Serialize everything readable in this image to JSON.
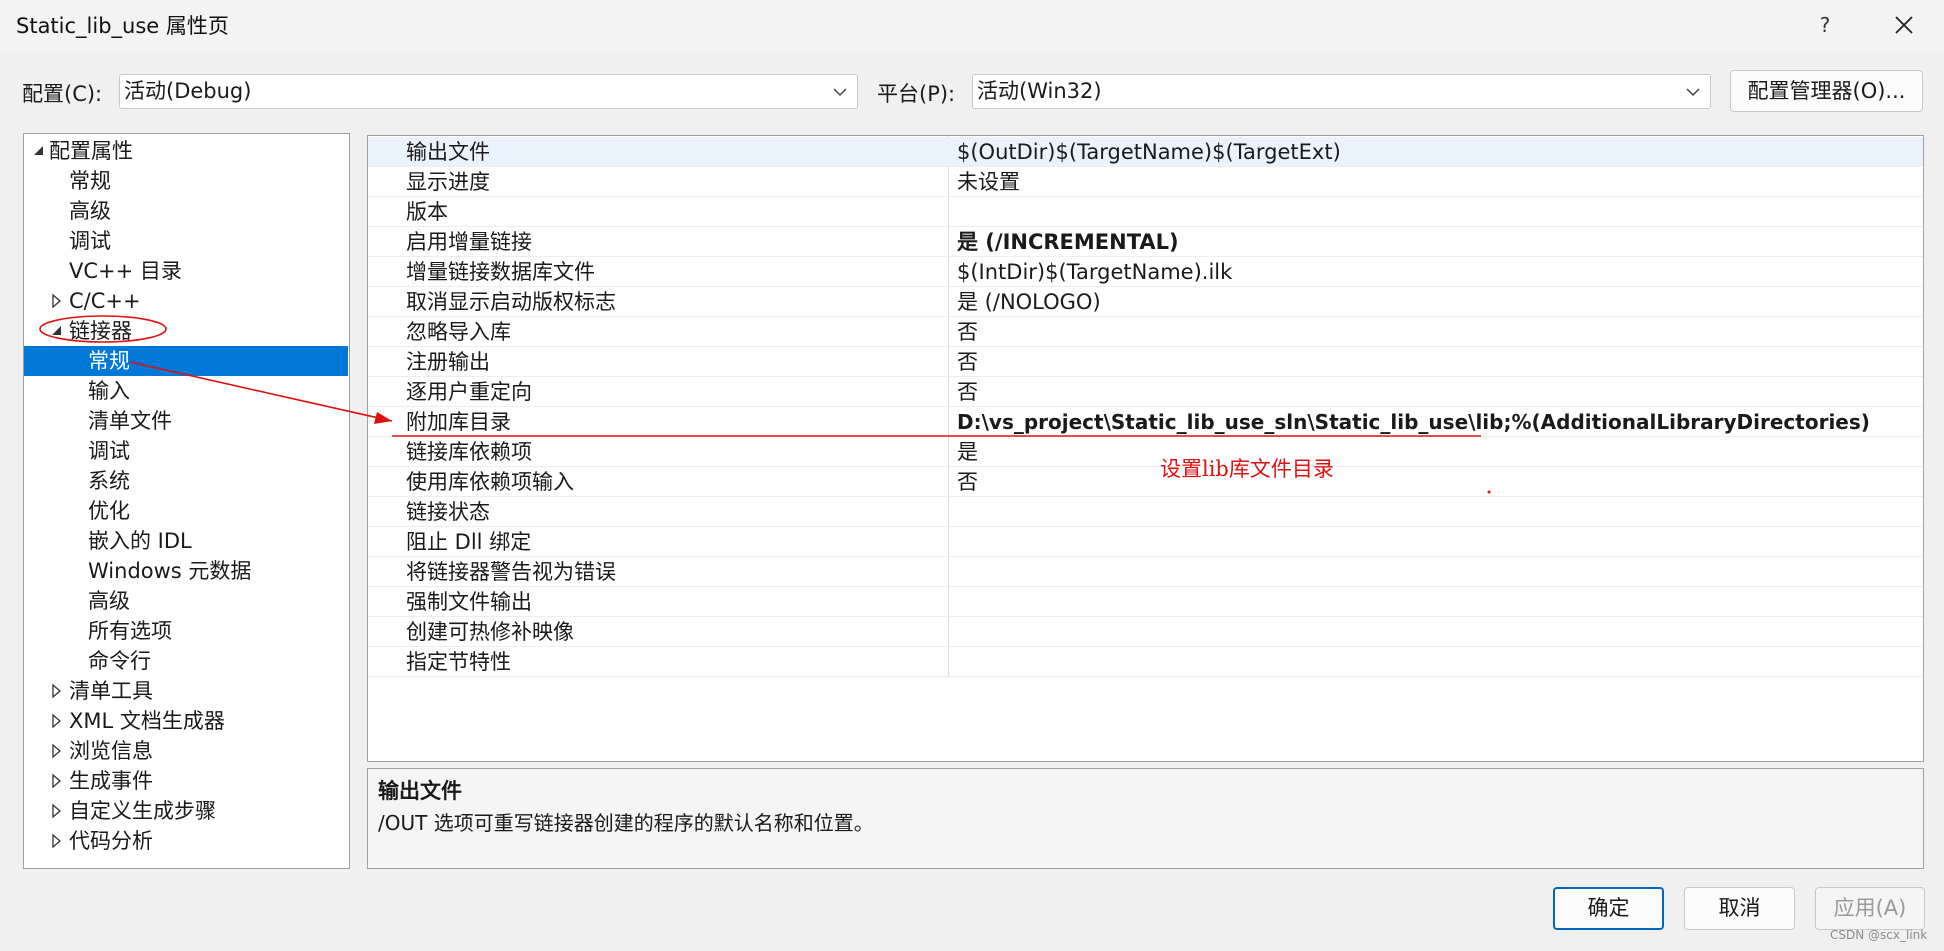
{
  "window": {
    "title": "Static_lib_use 属性页",
    "help_label": "?"
  },
  "config_bar": {
    "config_label": "配置(C):",
    "config_value": "活动(Debug)",
    "platform_label": "平台(P):",
    "platform_value": "活动(Win32)",
    "manager_button": "配置管理器(O)..."
  },
  "tree": {
    "root": "配置属性",
    "items": [
      {
        "label": "常规"
      },
      {
        "label": "高级"
      },
      {
        "label": "调试"
      },
      {
        "label": "VC++ 目录"
      },
      {
        "label": "C/C++"
      },
      {
        "label": "链接器"
      },
      {
        "label": "常规"
      },
      {
        "label": "输入"
      },
      {
        "label": "清单文件"
      },
      {
        "label": "调试"
      },
      {
        "label": "系统"
      },
      {
        "label": "优化"
      },
      {
        "label": "嵌入的 IDL"
      },
      {
        "label": "Windows 元数据"
      },
      {
        "label": "高级"
      },
      {
        "label": "所有选项"
      },
      {
        "label": "命令行"
      },
      {
        "label": "清单工具"
      },
      {
        "label": "XML 文档生成器"
      },
      {
        "label": "浏览信息"
      },
      {
        "label": "生成事件"
      },
      {
        "label": "自定义生成步骤"
      },
      {
        "label": "代码分析"
      }
    ]
  },
  "grid": {
    "rows": [
      {
        "name": "输出文件",
        "value": "$(OutDir)$(TargetName)$(TargetExt)"
      },
      {
        "name": "显示进度",
        "value": "未设置"
      },
      {
        "name": "版本",
        "value": ""
      },
      {
        "name": "启用增量链接",
        "value": "是 (/INCREMENTAL)"
      },
      {
        "name": "增量链接数据库文件",
        "value": "$(IntDir)$(TargetName).ilk"
      },
      {
        "name": "取消显示启动版权标志",
        "value": "是 (/NOLOGO)"
      },
      {
        "name": "忽略导入库",
        "value": "否"
      },
      {
        "name": "注册输出",
        "value": "否"
      },
      {
        "name": "逐用户重定向",
        "value": "否"
      },
      {
        "name": "附加库目录",
        "value": "D:\\vs_project\\Static_lib_use_sln\\Static_lib_use\\lib;%(AdditionalLibraryDirectories)"
      },
      {
        "name": "链接库依赖项",
        "value": "是"
      },
      {
        "name": "使用库依赖项输入",
        "value": "否"
      },
      {
        "name": "链接状态",
        "value": ""
      },
      {
        "name": "阻止 Dll 绑定",
        "value": ""
      },
      {
        "name": "将链接器警告视为错误",
        "value": ""
      },
      {
        "name": "强制文件输出",
        "value": ""
      },
      {
        "name": "创建可热修补映像",
        "value": ""
      },
      {
        "name": "指定节特性",
        "value": ""
      }
    ]
  },
  "description": {
    "title": "输出文件",
    "text": "/OUT 选项可重写链接器创建的程序的默认名称和位置。"
  },
  "footer": {
    "ok_button": "确定",
    "cancel_button": "取消",
    "apply_button": "应用(A)"
  },
  "annotation": {
    "text": "设置lib库文件目录",
    "color": "#e01010"
  },
  "watermark": "CSDN @scx_link",
  "colors": {
    "selection": "#0078d7",
    "primary_button_border": "#0067c0",
    "annotation": "#e01010"
  },
  "icons": {
    "close": "close-icon",
    "dropdown": "chevron-down-icon",
    "expanded": "triangle-expanded-icon",
    "collapsed": "triangle-collapsed-icon"
  }
}
